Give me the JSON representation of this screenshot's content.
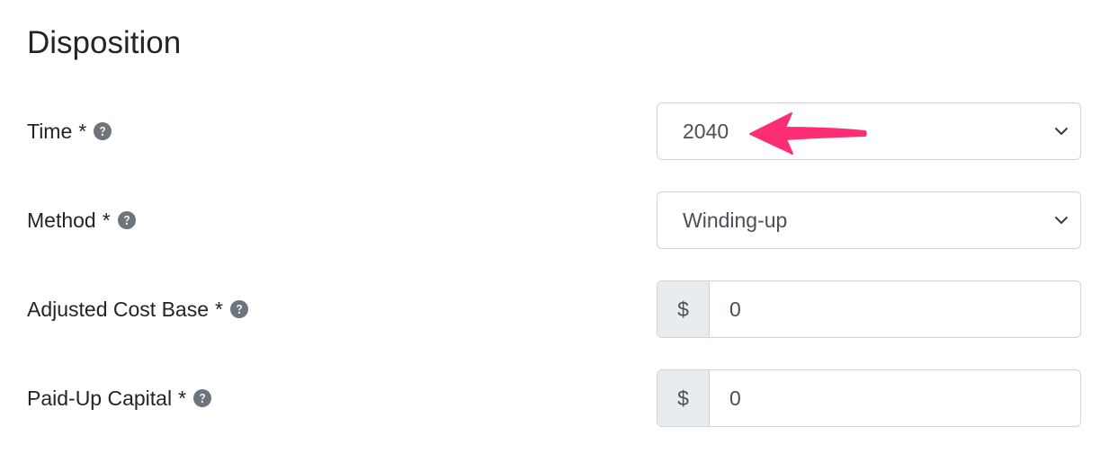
{
  "section": {
    "title": "Disposition"
  },
  "fields": {
    "time": {
      "label": "Time",
      "required_mark": "*",
      "value": "2040",
      "help_icon": "question-circle-icon"
    },
    "method": {
      "label": "Method",
      "required_mark": "*",
      "value": "Winding-up",
      "help_icon": "question-circle-icon"
    },
    "adjusted_cost_base": {
      "label": "Adjusted Cost Base",
      "required_mark": "*",
      "prefix": "$",
      "value": "0",
      "help_icon": "question-circle-icon"
    },
    "paid_up_capital": {
      "label": "Paid-Up Capital",
      "required_mark": "*",
      "prefix": "$",
      "value": "0",
      "help_icon": "question-circle-icon"
    }
  },
  "annotation": {
    "arrow_color": "#ff2d74",
    "icon": "pointer-arrow-icon"
  },
  "colors": {
    "text": "#212529",
    "input_text": "#495057",
    "border": "#ced4da",
    "addon_bg": "#e9ecef",
    "help_icon": "#6c757d"
  }
}
